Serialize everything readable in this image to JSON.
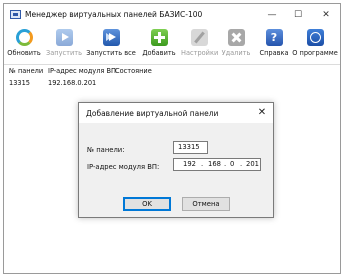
{
  "window": {
    "title": "Менеджер виртуальных панелей БАЗИС-100",
    "minimize": "—",
    "maximize": "☐",
    "close": "✕"
  },
  "toolbar": {
    "items": [
      {
        "label": "Обновить",
        "icon": "refresh-icon",
        "enabled": true
      },
      {
        "label": "Запустить",
        "icon": "play-icon",
        "enabled": false
      },
      {
        "label": "Запустить все",
        "icon": "play-all-icon",
        "enabled": true
      },
      {
        "label": "Добавить",
        "icon": "add-icon",
        "enabled": true
      },
      {
        "label": "Настройки",
        "icon": "settings-icon",
        "enabled": false
      },
      {
        "label": "Удалить",
        "icon": "delete-icon",
        "enabled": false
      },
      {
        "label": "Справка",
        "icon": "help-icon",
        "enabled": true
      },
      {
        "label": "О программе",
        "icon": "info-icon",
        "enabled": true
      }
    ],
    "help_glyph": "?"
  },
  "list": {
    "columns": [
      "№ панели",
      "IP-адрес модуля ВП",
      "Состояние"
    ],
    "rows": [
      [
        "13315",
        "192.168.0.201",
        ""
      ]
    ]
  },
  "dialog": {
    "title": "Добавление виртуальной панели",
    "close": "✕",
    "panel_label": "№ панели:",
    "panel_value": "13315",
    "ip_label": "IP-адрес модуля ВП:",
    "ip_octets": [
      "192",
      "168",
      "0",
      "201"
    ],
    "ip_dot": ".",
    "ok_label": "OK",
    "cancel_label": "Отмена"
  }
}
